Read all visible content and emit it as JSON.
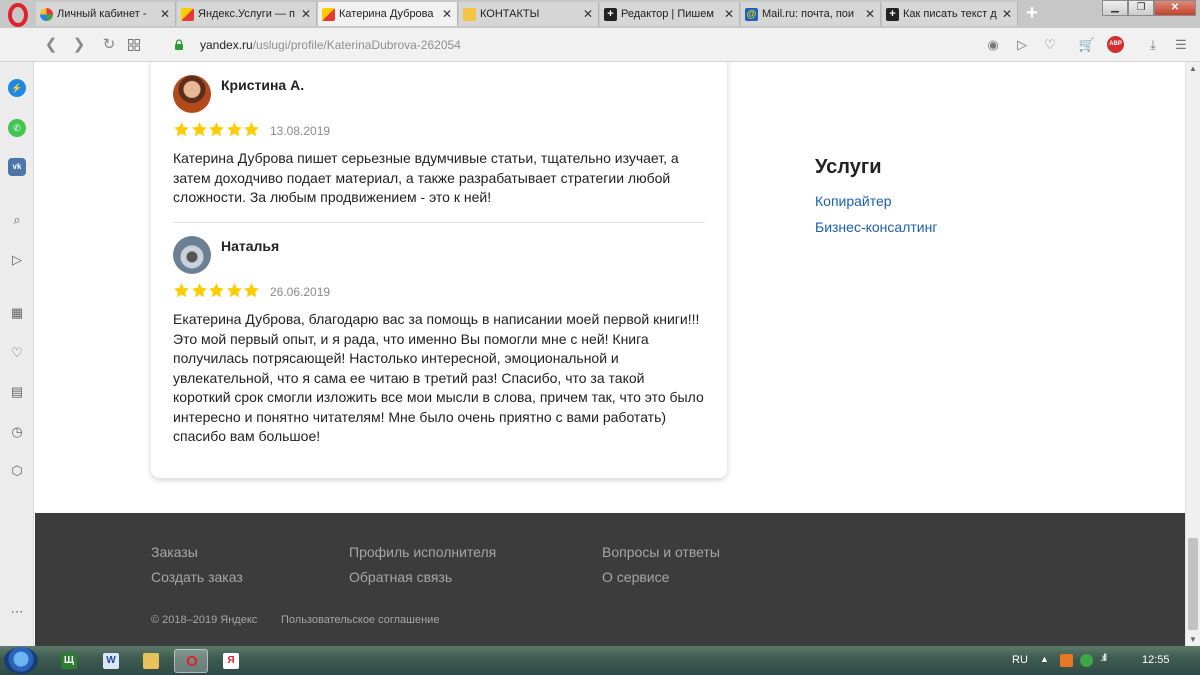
{
  "browser": {
    "tabs": [
      {
        "title": "Личный кабинет - ",
        "icon": "multicolor-dots-icon"
      },
      {
        "title": "Яндекс.Услуги — п",
        "icon": "yandex-services-icon"
      },
      {
        "title": "Катерина Дуброва",
        "icon": "yandex-services-icon"
      },
      {
        "title": "КОНТАКТЫ",
        "icon": "contacts-icon"
      },
      {
        "title": "Редактор | Пишем",
        "icon": "plus-square-icon"
      },
      {
        "title": "Mail.ru: почта, пои",
        "icon": "mail-ru-icon"
      },
      {
        "title": "Как писать текст д",
        "icon": "plus-square-icon"
      }
    ],
    "url_host": "yandex.ru",
    "url_path": "/uslugi/profile/KaterinaDubrova-262054",
    "adblock_label": "ABP",
    "accent": "#c0442b"
  },
  "reviews": [
    {
      "author": "Кристина А.",
      "rating": 5,
      "date": "13.08.2019",
      "text": "Катерина Дуброва пишет серьезные вдумчивые статьи, тщательно изучает, а затем доходчиво подает материал, а также разрабатывает стратегии любой сложности. За любым продвижением - это к ней!"
    },
    {
      "author": "Наталья",
      "rating": 5,
      "date": "26.06.2019",
      "text": "Екатерина Дуброва, благодарю вас за помощь в написании моей первой книги!!! Это мой первый опыт, и я рада, что именно Вы помогли мне с ней! Книга получилась потрясающей! Настолько интересной, эмоциональной и увлекательной, что я сама ее читаю в третий раз! Спасибо, что за такой короткий срок смогли изложить все мои мысли в слова, причем так, что это было интересно и понятно читателям! Мне было очень приятно с вами работать) спасибо вам большое!"
    }
  ],
  "services": {
    "title": "Услуги",
    "items": [
      "Копирайтер",
      "Бизнес-консалтинг"
    ]
  },
  "footer": {
    "col1": [
      "Заказы",
      "Создать заказ"
    ],
    "col2": [
      "Профиль исполнителя",
      "Обратная связь"
    ],
    "col3": [
      "Вопросы и ответы",
      "О сервисе"
    ],
    "copyright": "© 2018–2019 Яндекс",
    "agreement": "Пользовательское соглашение"
  },
  "colors": {
    "star": "#ffcc00",
    "link": "#1a5fb4",
    "footer_bg": "#3c3c3c"
  },
  "taskbar": {
    "language": "RU",
    "time": "12:55"
  }
}
